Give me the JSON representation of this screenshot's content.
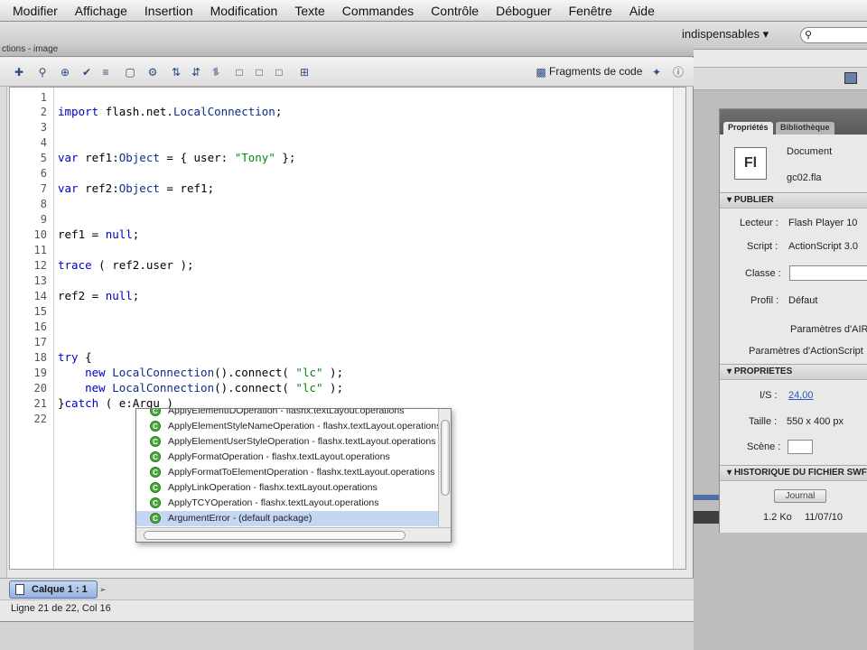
{
  "menubar": [
    "Modifier",
    "Affichage",
    "Insertion",
    "Modification",
    "Texte",
    "Commandes",
    "Contrôle",
    "Déboguer",
    "Fenêtre",
    "Aide"
  ],
  "workspace": {
    "selector": "indispensables ▾",
    "search_icon": "search-icon"
  },
  "actions_panel": {
    "title": "ctions - image",
    "snippets_label": "Fragments de code",
    "toolbar_icons": [
      "add-icon",
      "find-icon",
      "target-icon",
      "check-icon",
      "format-icon",
      "code-hint-icon",
      "debug-icon",
      "collapse-icon",
      "expand-icon",
      "expand-all-icon",
      "comment-block-icon",
      "comment-line-icon",
      "uncomment-icon",
      "toolbox-icon",
      "wand-icon",
      "help-icon"
    ]
  },
  "code_lines": [
    {
      "n": "1",
      "text": ""
    },
    {
      "n": "2",
      "text": "import flash.net.LocalConnection;"
    },
    {
      "n": "3",
      "text": ""
    },
    {
      "n": "4",
      "text": ""
    },
    {
      "n": "5",
      "text": "var ref1:Object = { user: \"Tony\" };"
    },
    {
      "n": "6",
      "text": ""
    },
    {
      "n": "7",
      "text": "var ref2:Object = ref1;"
    },
    {
      "n": "8",
      "text": ""
    },
    {
      "n": "9",
      "text": ""
    },
    {
      "n": "10",
      "text": "ref1 = null;"
    },
    {
      "n": "11",
      "text": ""
    },
    {
      "n": "12",
      "text": "trace ( ref2.user );"
    },
    {
      "n": "13",
      "text": ""
    },
    {
      "n": "14",
      "text": "ref2 = null;"
    },
    {
      "n": "15",
      "text": ""
    },
    {
      "n": "16",
      "text": ""
    },
    {
      "n": "17",
      "text": ""
    },
    {
      "n": "18",
      "text": "try {"
    },
    {
      "n": "19",
      "text": "    new LocalConnection().connect( \"lc\" );"
    },
    {
      "n": "20",
      "text": "    new LocalConnection().connect( \"lc\" );"
    },
    {
      "n": "21",
      "text": "}catch ( e:Argu )"
    },
    {
      "n": "22",
      "text": ""
    }
  ],
  "code_hints": [
    "ApplyElementIDOperation - flashx.textLayout.operations",
    "ApplyElementStyleNameOperation - flashx.textLayout.operations",
    "ApplyElementUserStyleOperation - flashx.textLayout.operations",
    "ApplyFormatOperation - flashx.textLayout.operations",
    "ApplyFormatToElementOperation - flashx.textLayout.operations",
    "ApplyLinkOperation - flashx.textLayout.operations",
    "ApplyTCYOperation - flashx.textLayout.operations",
    "ArgumentError - (default package)"
  ],
  "selected_hint": "ArgumentError - (default package)",
  "layer_tab": "Calque 1 : 1",
  "status": "Ligne 21 de 22, Col 16",
  "properties": {
    "tab_props": "Propriétés",
    "tab_library": "Bibliothèque",
    "doc_type": "Document",
    "doc_name": "gc02.fla",
    "fl_icon_label": "Fl",
    "section_publish": "PUBLIER",
    "player_label": "Lecteur :",
    "player_value": "Flash Player 10",
    "script_label": "Script :",
    "script_value": "ActionScript 3.0",
    "class_label": "Classe :",
    "profile_label": "Profil :",
    "profile_value": "Défaut",
    "air_settings": "Paramètres d'AIR",
    "as_settings": "Paramètres d'ActionScript",
    "section_properties": "PROPRIETES",
    "fps_label": "I/S :",
    "fps_value": "24,00",
    "size_label": "Taille :",
    "size_value": "550 x 400 px",
    "stage_label": "Scène :",
    "section_history": "HISTORIQUE DU FICHIER SWF",
    "journal_button": "Journal",
    "history_size": "1.2 Ko",
    "history_date": "11/07/10"
  }
}
